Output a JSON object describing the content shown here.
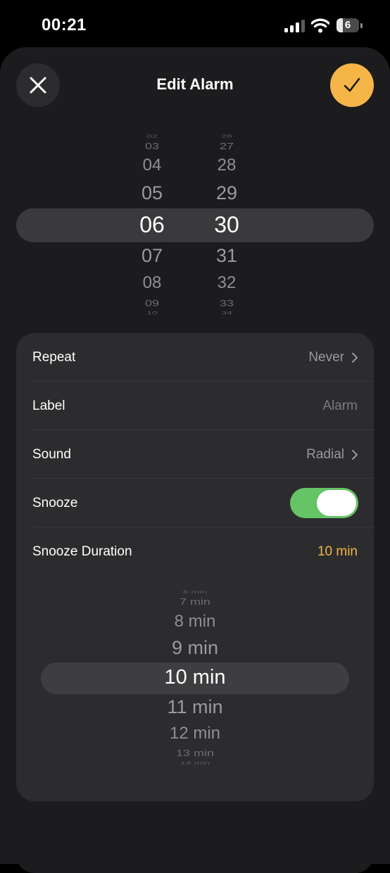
{
  "status_bar": {
    "time": "00:21",
    "battery": "6"
  },
  "header": {
    "title": "Edit Alarm",
    "close_icon": "close-icon",
    "confirm_icon": "checkmark-icon"
  },
  "time_picker": {
    "hours": {
      "items": [
        "02",
        "03",
        "04",
        "05",
        "06",
        "07",
        "08",
        "09",
        "10"
      ],
      "selected": "06"
    },
    "minutes": {
      "items": [
        "26",
        "27",
        "28",
        "29",
        "30",
        "31",
        "32",
        "33",
        "34"
      ],
      "selected": "30"
    }
  },
  "settings": {
    "repeat": {
      "label": "Repeat",
      "value": "Never"
    },
    "label": {
      "label": "Label",
      "placeholder": "Alarm"
    },
    "sound": {
      "label": "Sound",
      "value": "Radial"
    },
    "snooze": {
      "label": "Snooze",
      "enabled": true
    },
    "snooze_duration": {
      "label": "Snooze Duration",
      "value": "10 min"
    }
  },
  "snooze_picker": {
    "items": [
      "6 min",
      "7 min",
      "8 min",
      "9 min",
      "10 min",
      "11 min",
      "12 min",
      "13 min",
      "14 min"
    ],
    "selected": "10 min"
  },
  "colors": {
    "accent": "#f5b547",
    "toggle_on": "#65c466",
    "sheet": "#1c1c1e",
    "card": "#2c2c2e"
  }
}
